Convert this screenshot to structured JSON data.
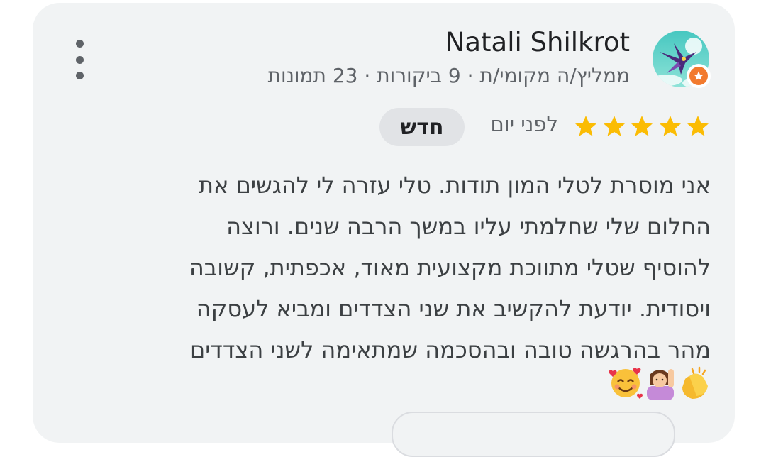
{
  "reviewer": {
    "name": "Natali Shilkrot",
    "subtitle": "ממליץ/ה מקומי/ת · 9 ביקורות · 23 תמונות",
    "avatar_icon": "bird-avatar-icon",
    "badge_icon": "local-guide-star-icon"
  },
  "menu": {
    "icon": "more-vert-icon"
  },
  "rating": {
    "stars": 5,
    "max": 5,
    "color": "#fbbc04"
  },
  "time": "לפני יום",
  "new_badge": "חדש",
  "review": {
    "lines": [
      "אני מוסרת לטלי המון תודות. טלי עזרה לי להגשים את",
      "החלום שלי שחלמתי עליו במשך הרבה שנים. ורוצה",
      "להוסיף שטלי מתווכת מקצועית מאוד, אכפתית, קשובה",
      "ויסודית. יודעת להקשיב את שני הצדדים ומביא לעסקה",
      "מהר בהרגשה טובה ובהסכמה שמתאימה לשני הצדדים"
    ],
    "emojis": [
      "clapping-hands-emoji",
      "person-raising-hand-emoji",
      "smiling-face-with-hearts-emoji"
    ]
  },
  "colors": {
    "card_bg": "#f1f3f4",
    "accent_orange": "#f27a2e",
    "badge_bg": "#e1e3e6"
  }
}
